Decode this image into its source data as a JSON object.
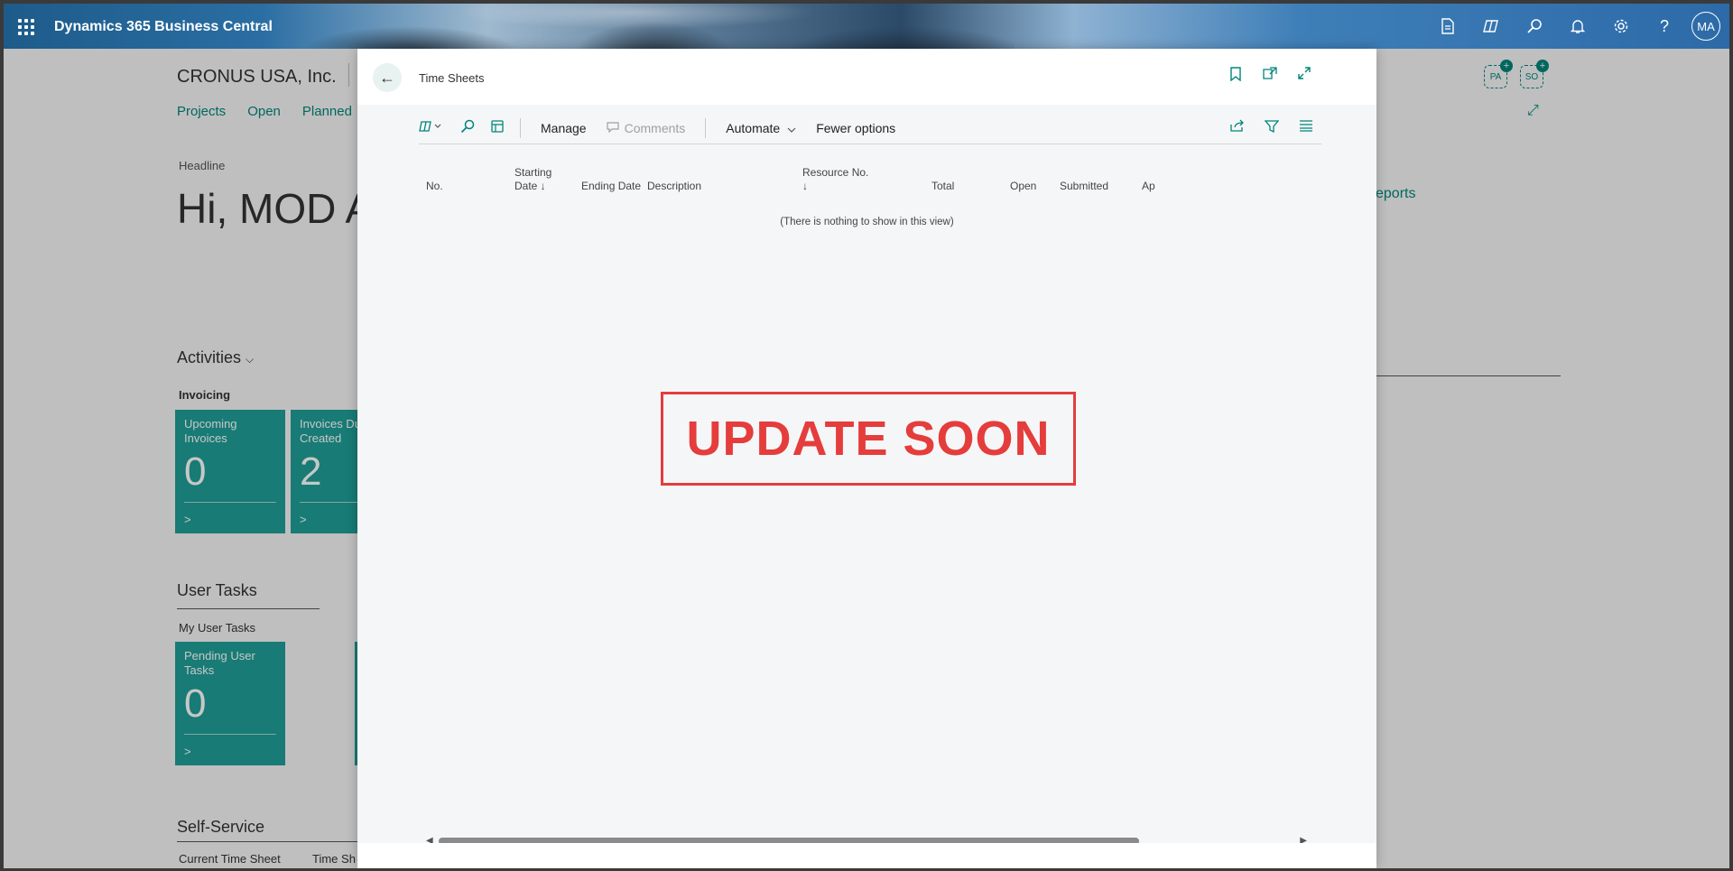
{
  "topbar": {
    "brand": "Dynamics 365 Business Central",
    "avatar": "MA",
    "icons": [
      "document-icon",
      "copilot-icon",
      "search-icon",
      "bell-icon",
      "gear-icon",
      "help-icon"
    ]
  },
  "background": {
    "company": "CRONUS USA, Inc.",
    "nav": [
      "Projects",
      "Open",
      "Planned"
    ],
    "headline_label": "Headline",
    "greeting": "Hi, MOD A",
    "reports_link": "eports",
    "badges": [
      "PA",
      "SO"
    ],
    "activities": {
      "title": "Activities",
      "invoicing_label": "Invoicing",
      "tiles": [
        {
          "title": "Upcoming Invoices",
          "value": "0"
        },
        {
          "title": "Invoices Due Created",
          "value": "2"
        }
      ]
    },
    "user_tasks": {
      "title": "User Tasks",
      "sub_label": "My User Tasks",
      "tiles": [
        {
          "title": "Pending User Tasks",
          "value": "0"
        }
      ]
    },
    "self_service": {
      "title": "Self-Service",
      "items": [
        "Current Time Sheet",
        "Time Sh"
      ]
    }
  },
  "dialog": {
    "title": "Time Sheets",
    "actions": {
      "manage": "Manage",
      "comments": "Comments",
      "automate": "Automate",
      "fewer_options": "Fewer options"
    },
    "columns": [
      {
        "label": "No."
      },
      {
        "label": "Starting",
        "label2": "Date ↓"
      },
      {
        "label": "Ending Date"
      },
      {
        "label": "Description"
      },
      {
        "label": "Resource No.",
        "label2": "↓"
      },
      {
        "label": "Total"
      },
      {
        "label": "Open"
      },
      {
        "label": "Submitted"
      },
      {
        "label": "Ap"
      }
    ],
    "empty_message": "(There is nothing to show in this view)",
    "stamp": "UPDATE SOON"
  }
}
